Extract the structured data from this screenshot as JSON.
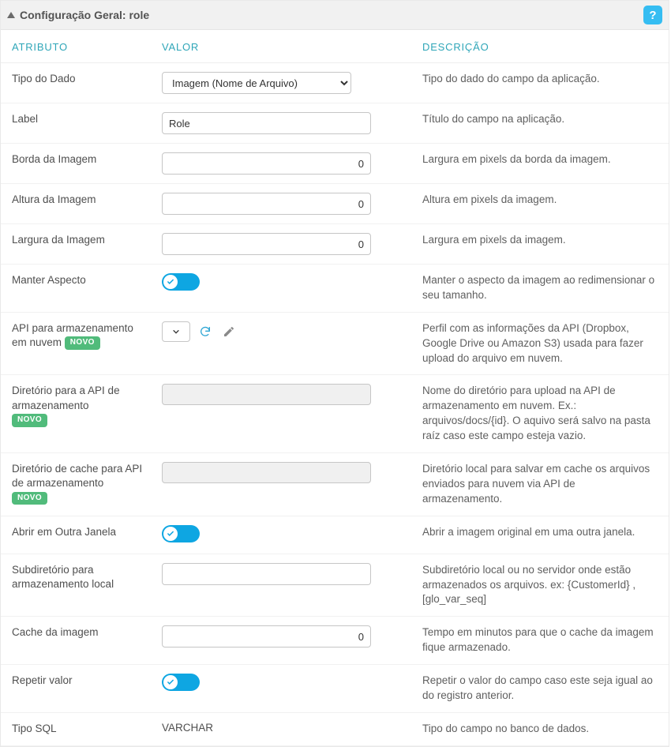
{
  "header": {
    "title": "Configuração Geral: role",
    "help": "?"
  },
  "columns": {
    "attr": "ATRIBUTO",
    "val": "VALOR",
    "desc": "DESCRIÇÃO"
  },
  "badge_novo": "NOVO",
  "rows": {
    "tipo_dado": {
      "attr": "Tipo do Dado",
      "val": "Imagem (Nome de Arquivo)",
      "desc": "Tipo do dado do campo da aplicação."
    },
    "label": {
      "attr": "Label",
      "val": "Role",
      "desc": "Título do campo na aplicação."
    },
    "borda": {
      "attr": "Borda da Imagem",
      "val": "0",
      "desc": "Largura em pixels da borda da imagem."
    },
    "altura": {
      "attr": "Altura da Imagem",
      "val": "0",
      "desc": "Altura em pixels da imagem."
    },
    "largura": {
      "attr": "Largura da Imagem",
      "val": "0",
      "desc": "Largura em pixels da imagem."
    },
    "manter": {
      "attr": "Manter Aspecto",
      "desc": "Manter o aspecto da imagem ao redimensionar o seu tamanho."
    },
    "api": {
      "attr": "API para armazenamento em nuvem",
      "desc": "Perfil com as informações da API (Dropbox, Google Drive ou Amazon S3) usada para fazer upload do arquivo em nuvem."
    },
    "dir_api": {
      "attr": "Diretório para a API de armazenamento",
      "desc": "Nome do diretório para upload na API de armazenamento em nuvem. Ex.: arquivos/docs/{id}. O aquivo será salvo na pasta raíz caso este campo esteja vazio."
    },
    "dir_cache": {
      "attr": "Diretório de cache para API de armazenamento",
      "desc": "Diretório local para salvar em cache os arquivos enviados para nuvem via API de armazenamento."
    },
    "abrir": {
      "attr": "Abrir em Outra Janela",
      "desc": "Abrir a imagem original em uma outra janela."
    },
    "subdir": {
      "attr": "Subdiretório para armazenamento local",
      "val": "",
      "desc": "Subdiretório local ou no servidor onde estão armazenados os arquivos. ex: {CustomerId} , [glo_var_seq]"
    },
    "cache": {
      "attr": "Cache da imagem",
      "val": "0",
      "desc": "Tempo em minutos para que o cache da imagem fique armazenado."
    },
    "repetir": {
      "attr": "Repetir valor",
      "desc": "Repetir o valor do campo caso este seja igual ao do registro anterior."
    },
    "tiposql": {
      "attr": "Tipo SQL",
      "val": "VARCHAR",
      "desc": "Tipo do campo no banco de dados."
    }
  }
}
